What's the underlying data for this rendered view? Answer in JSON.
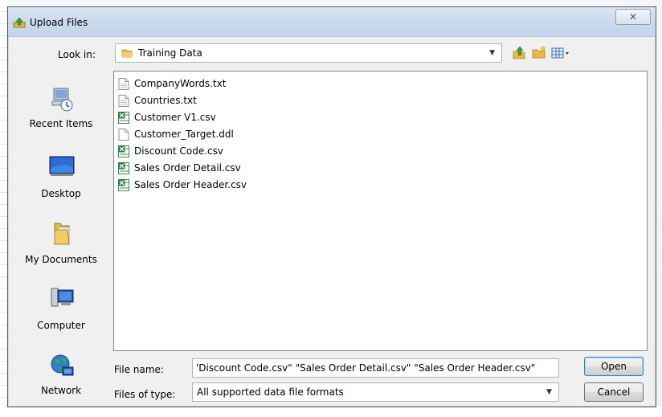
{
  "dialog": {
    "title": "Upload Files",
    "close_label": "✕"
  },
  "lookin": {
    "label": "Look in:",
    "value": "Training Data"
  },
  "places": [
    {
      "label": "Recent Items",
      "icon": "recent-items-icon"
    },
    {
      "label": "Desktop",
      "icon": "desktop-icon"
    },
    {
      "label": "My Documents",
      "icon": "my-documents-icon"
    },
    {
      "label": "Computer",
      "icon": "computer-icon"
    },
    {
      "label": "Network",
      "icon": "network-icon"
    }
  ],
  "files": [
    {
      "name": "CompanyWords.txt",
      "type": "txt"
    },
    {
      "name": "Countries.txt",
      "type": "txt"
    },
    {
      "name": "Customer V1.csv",
      "type": "csv"
    },
    {
      "name": "Customer_Target.ddl",
      "type": "ddl"
    },
    {
      "name": "Discount Code.csv",
      "type": "csv"
    },
    {
      "name": "Sales Order Detail.csv",
      "type": "csv"
    },
    {
      "name": "Sales Order Header.csv",
      "type": "csv"
    }
  ],
  "filename": {
    "label": "File name:",
    "value": "'Discount Code.csv\" \"Sales Order Detail.csv\" \"Sales Order Header.csv\""
  },
  "filetype": {
    "label": "Files of type:",
    "value": "All supported data file formats"
  },
  "buttons": {
    "open": "Open",
    "cancel": "Cancel"
  },
  "colors": {
    "excel_green": "#1f7a3a",
    "folder_yellow": "#e8b84a",
    "titlebar": "#cbd9ec"
  }
}
